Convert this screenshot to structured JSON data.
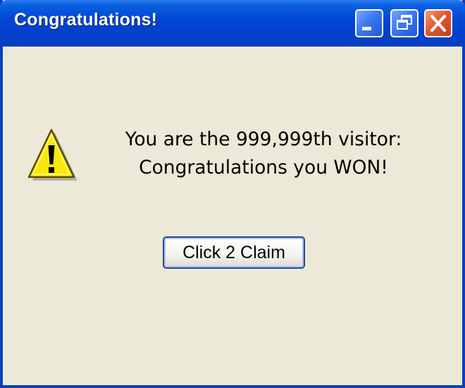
{
  "window": {
    "title": "Congratulations!"
  },
  "titlebar_buttons": {
    "minimize": "minimize-icon",
    "restore": "restore-icon",
    "close": "close-icon"
  },
  "dialog": {
    "icon": "warning-icon",
    "message_line1": "You are the 999,999th visitor:",
    "message_line2": "Congratulations you WON!",
    "button_label": "Click 2 Claim"
  },
  "colors": {
    "titlebar": "#0347d6",
    "window_body": "#ece9d8",
    "close_button": "#e05a30",
    "warning_fill": "#f8e80c"
  }
}
